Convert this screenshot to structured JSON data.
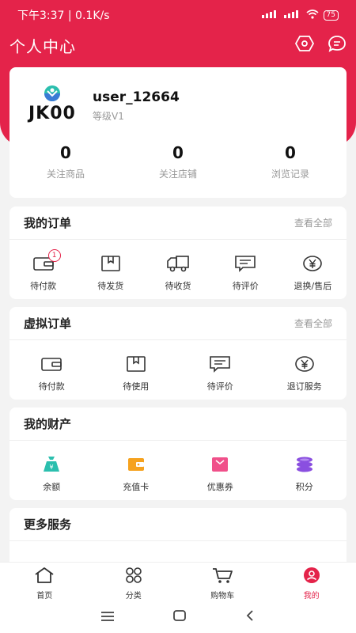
{
  "status": {
    "time": "下午3:37 | 0.1K/s",
    "battery": "75"
  },
  "header": {
    "title": "个人中心"
  },
  "profile": {
    "logo_text": "JK00",
    "username": "user_12664",
    "level": "等级V1",
    "stats": [
      {
        "value": "0",
        "label": "关注商品"
      },
      {
        "value": "0",
        "label": "关注店铺"
      },
      {
        "value": "0",
        "label": "浏览记录"
      }
    ]
  },
  "orders": {
    "title": "我的订单",
    "see_all": "查看全部",
    "items": [
      {
        "label": "待付款",
        "icon": "wallet-icon",
        "badge": "1"
      },
      {
        "label": "待发货",
        "icon": "package-icon"
      },
      {
        "label": "待收货",
        "icon": "truck-icon"
      },
      {
        "label": "待评价",
        "icon": "comment-icon"
      },
      {
        "label": "退换/售后",
        "icon": "yen-icon"
      }
    ]
  },
  "virtual_orders": {
    "title": "虚拟订单",
    "see_all": "查看全部",
    "items": [
      {
        "label": "待付款",
        "icon": "wallet-icon"
      },
      {
        "label": "待使用",
        "icon": "package-icon"
      },
      {
        "label": "待评价",
        "icon": "comment-icon"
      },
      {
        "label": "退订服务",
        "icon": "yen-icon"
      }
    ]
  },
  "assets": {
    "title": "我的财产",
    "items": [
      {
        "label": "余额",
        "icon": "money-bag-icon",
        "color": "#2bbfae"
      },
      {
        "label": "充值卡",
        "icon": "card-wallet-icon",
        "color": "#f6a21e"
      },
      {
        "label": "优惠券",
        "icon": "coupon-icon",
        "color": "#f0508a"
      },
      {
        "label": "积分",
        "icon": "coins-icon",
        "color": "#8a4fe0"
      }
    ]
  },
  "more_services": {
    "title": "更多服务"
  },
  "tabbar": {
    "items": [
      {
        "label": "首页",
        "icon": "home-icon"
      },
      {
        "label": "分类",
        "icon": "category-icon"
      },
      {
        "label": "购物车",
        "icon": "cart-icon"
      },
      {
        "label": "我的",
        "icon": "user-icon",
        "active": true
      }
    ]
  },
  "colors": {
    "brand": "#e4234a",
    "background": "#f3f3f3"
  }
}
